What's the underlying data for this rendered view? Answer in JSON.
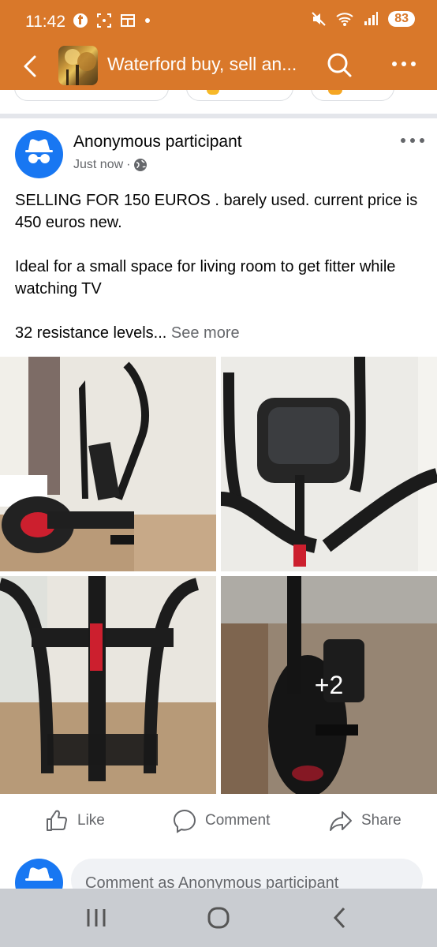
{
  "status_bar": {
    "time": "11:42",
    "battery": "83",
    "left_icons": [
      "facebook-icon",
      "screenshot-icon",
      "calendar-icon",
      "dot-icon"
    ],
    "right_icons": [
      "mute-icon",
      "wifi-icon",
      "signal-icon"
    ]
  },
  "app_bar": {
    "title": "Waterford buy, sell an...",
    "accent": "#d9782a"
  },
  "post": {
    "author": "Anonymous participant",
    "time": "Just now",
    "separator": "·",
    "paragraphs": [
      "SELLING FOR 150 EUROS . barely used. current price is 450 euros new.",
      "Ideal for a small space for living room to get fitter while watching TV"
    ],
    "last_line": "32 resistance levels...",
    "see_more": "See more",
    "more_photos": "+2"
  },
  "actions": {
    "like": "Like",
    "comment": "Comment",
    "share": "Share"
  },
  "comment_input": {
    "placeholder": "Comment as Anonymous participant"
  },
  "colors": {
    "brand_blue": "#1877f2",
    "secondary_text": "#65676b"
  }
}
